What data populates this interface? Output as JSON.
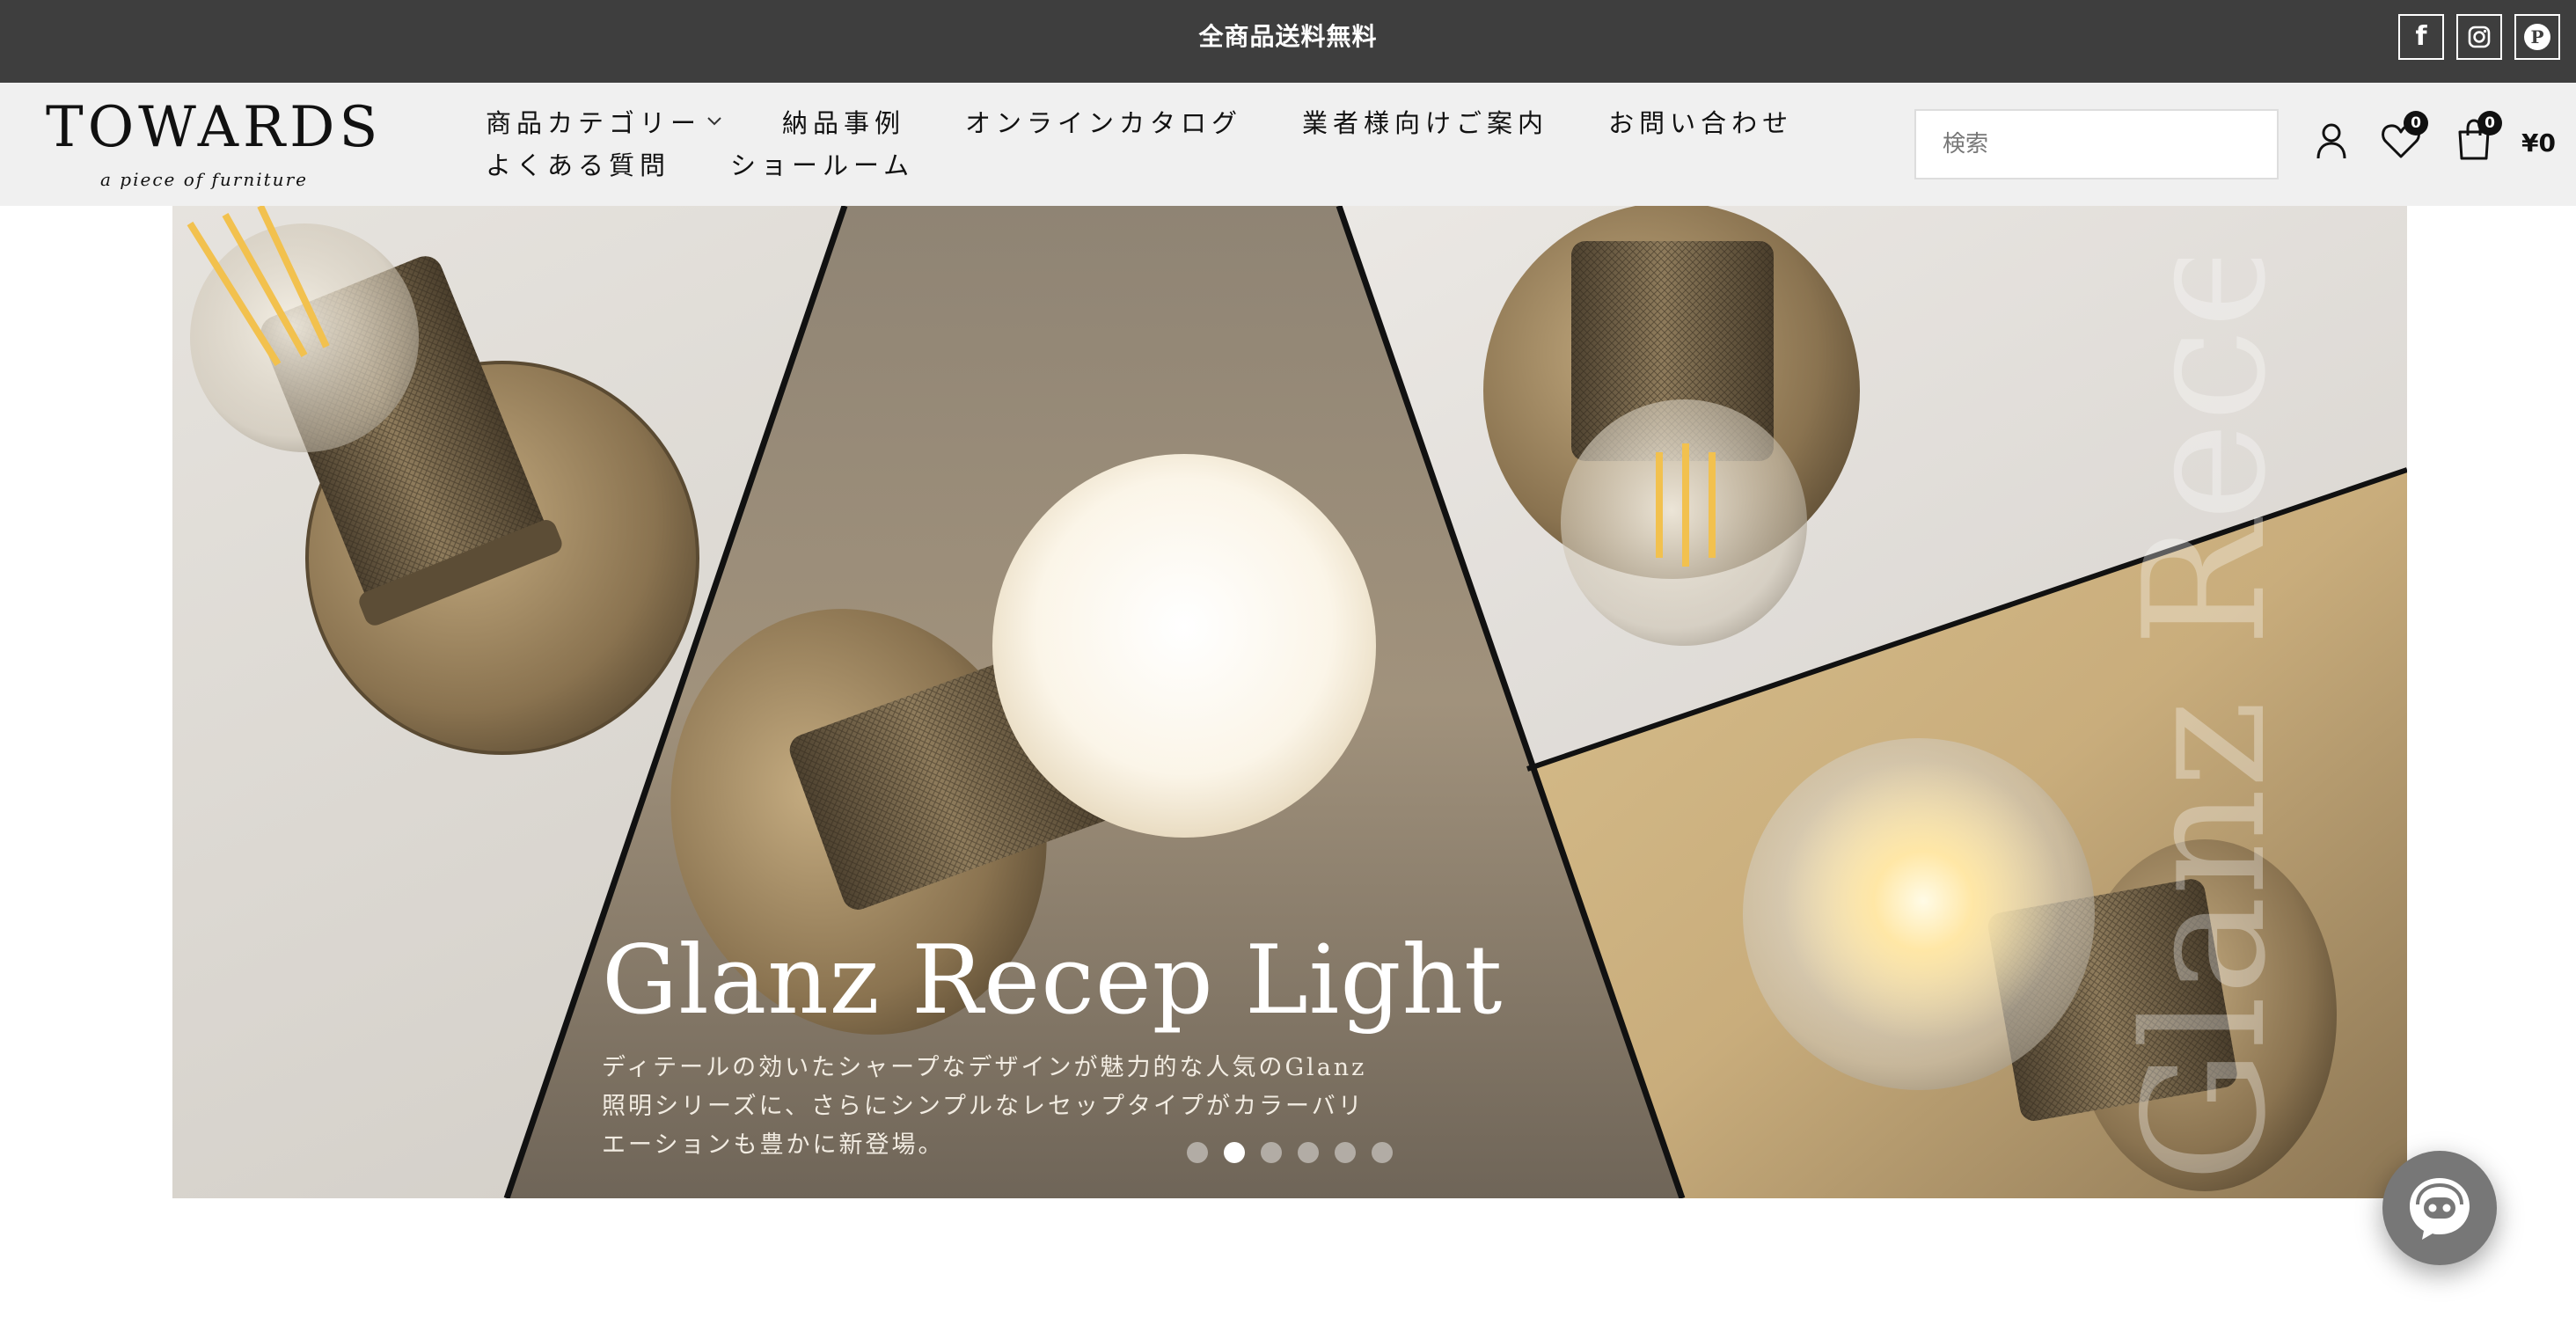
{
  "announcement": {
    "text": "全商品送料無料"
  },
  "social": [
    {
      "name": "facebook-icon",
      "glyph": "f"
    },
    {
      "name": "instagram-icon"
    },
    {
      "name": "pinterest-icon",
      "glyph": "P"
    }
  ],
  "logo": {
    "brand": "TOWARDS",
    "tagline": "a piece of furniture"
  },
  "nav": {
    "row1": [
      {
        "label": "商品カテゴリー",
        "has_dropdown": true
      },
      {
        "label": "納品事例"
      },
      {
        "label": "オンラインカタログ"
      },
      {
        "label": "業者様向けご案内"
      },
      {
        "label": "お問い合わせ"
      }
    ],
    "row2": [
      {
        "label": "よくある質問"
      },
      {
        "label": "ショールーム"
      }
    ]
  },
  "search": {
    "placeholder": "検索",
    "value": ""
  },
  "account": {
    "icon": "user-icon"
  },
  "wishlist": {
    "icon": "heart-icon",
    "count": "0"
  },
  "cart": {
    "icon": "bag-icon",
    "count": "0",
    "total": "¥0"
  },
  "hero": {
    "title": "Glanz Recep Light",
    "description_lines": [
      "ディテールの効いたシャープなデザインが魅力的な人気のGlanz",
      "照明シリーズに、さらにシンプルなレセップタイプがカラーバリ",
      "エーションも豊かに新登場。"
    ],
    "vertical_text": "Glanz Recep",
    "slides_total": 6,
    "active_slide": 2
  },
  "chat": {
    "icon": "chat-support-icon"
  },
  "colors": {
    "topbar_bg": "#3e3e3e",
    "header_bg": "#f0f0f0",
    "text": "#111111",
    "brass": "#8a7350"
  }
}
